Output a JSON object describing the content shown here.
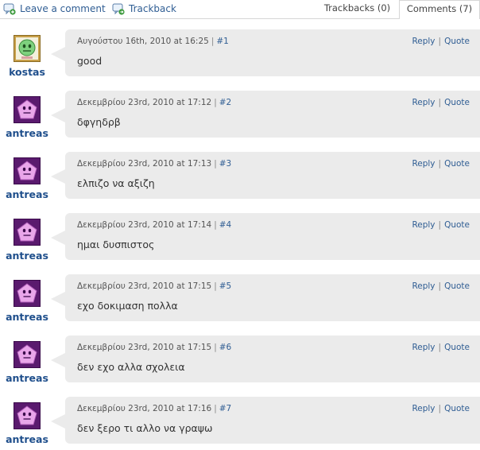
{
  "topbar": {
    "leave_comment": "Leave a comment",
    "trackback": "Trackback",
    "tabs": [
      {
        "label": "Trackbacks (0)",
        "active": false
      },
      {
        "label": "Comments (7)",
        "active": true
      }
    ]
  },
  "actions": {
    "reply": "Reply",
    "quote": "Quote",
    "separator": "|"
  },
  "colors": {
    "link": "#2f5d93",
    "author": "#1f4f8c",
    "bubble": "#ebebeb"
  },
  "comments": [
    {
      "author": "kostas",
      "avatar": "green-smiley-avatar",
      "date": "Αυγούστου 16th, 2010 at 16:25",
      "number": "#1",
      "text": "good"
    },
    {
      "author": "antreas",
      "avatar": "purple-pentagon-avatar",
      "date": "Δεκεμβρίου 23rd, 2010 at 17:12",
      "number": "#2",
      "text": "δφγηδρβ"
    },
    {
      "author": "antreas",
      "avatar": "purple-pentagon-avatar",
      "date": "Δεκεμβρίου 23rd, 2010 at 17:13",
      "number": "#3",
      "text": "ελπιζο να αξιζη"
    },
    {
      "author": "antreas",
      "avatar": "purple-pentagon-avatar",
      "date": "Δεκεμβρίου 23rd, 2010 at 17:14",
      "number": "#4",
      "text": "ημαι δυσπιστος"
    },
    {
      "author": "antreas",
      "avatar": "purple-pentagon-avatar",
      "date": "Δεκεμβρίου 23rd, 2010 at 17:15",
      "number": "#5",
      "text": "εχο δοκιμαση πολλα"
    },
    {
      "author": "antreas",
      "avatar": "purple-pentagon-avatar",
      "date": "Δεκεμβρίου 23rd, 2010 at 17:15",
      "number": "#6",
      "text": "δεν εχο αλλα σχολεια"
    },
    {
      "author": "antreas",
      "avatar": "purple-pentagon-avatar",
      "date": "Δεκεμβρίου 23rd, 2010 at 17:16",
      "number": "#7",
      "text": "δεν ξερο τι αλλο να γραψω"
    }
  ]
}
